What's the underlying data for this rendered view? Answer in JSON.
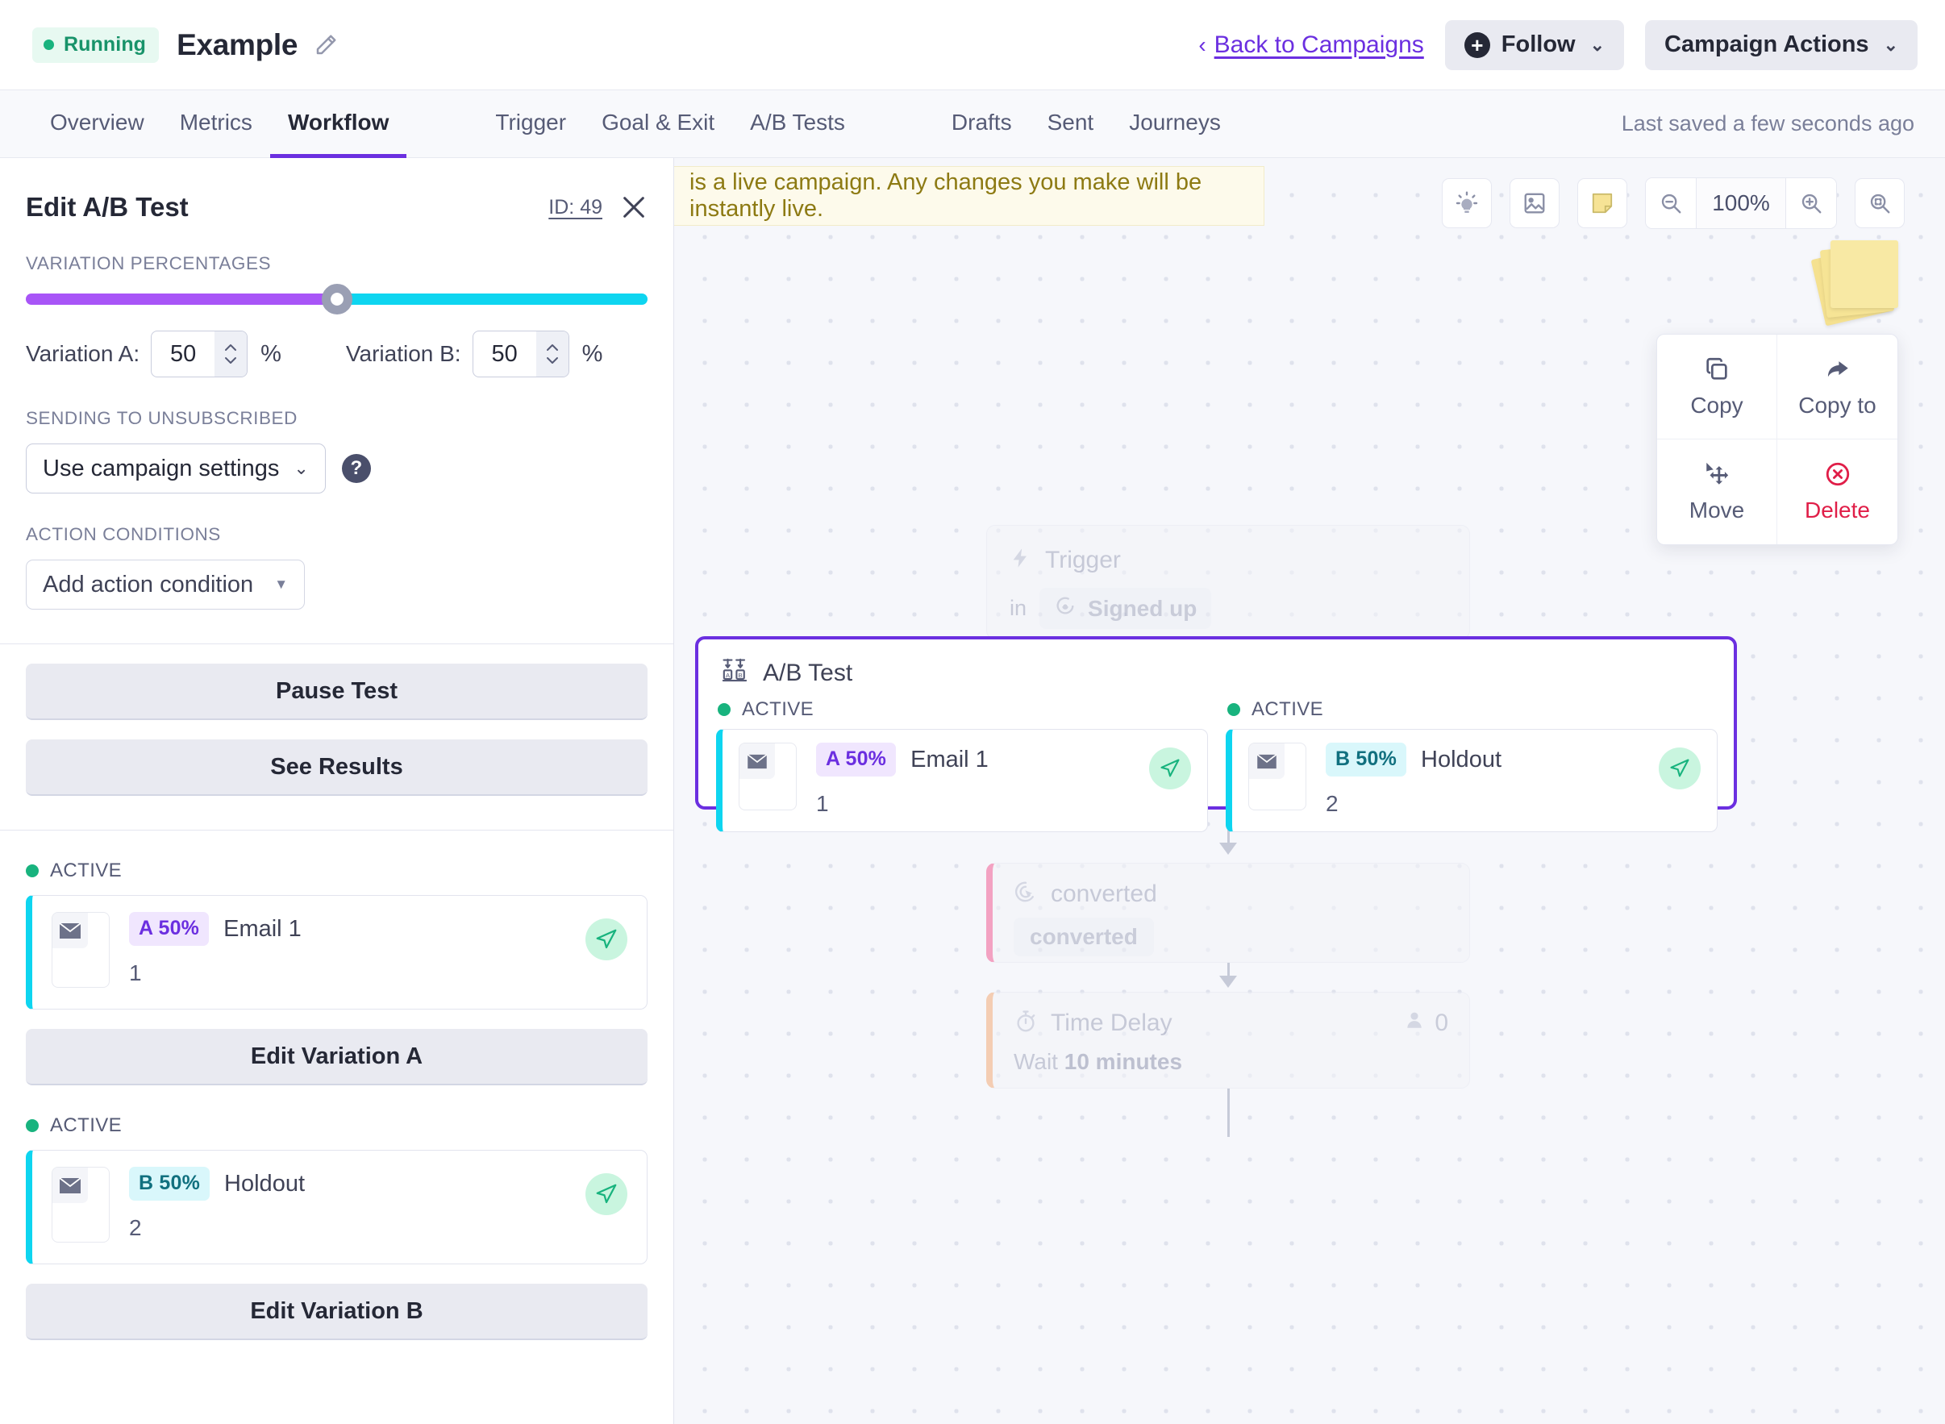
{
  "header": {
    "status_label": "Running",
    "campaign_title": "Example",
    "edit_icon": "pencil-icon",
    "back_link": "Back to Campaigns",
    "back_chevron": "‹",
    "follow_label": "Follow",
    "campaign_actions_label": "Campaign Actions",
    "caret": "⌄"
  },
  "tabs": {
    "group1": [
      "Overview",
      "Metrics",
      "Workflow"
    ],
    "group2": [
      "Trigger",
      "Goal & Exit",
      "A/B Tests"
    ],
    "group3": [
      "Drafts",
      "Sent",
      "Journeys"
    ],
    "active": "Workflow",
    "saved_note": "Last saved a few seconds ago"
  },
  "panel": {
    "title": "Edit A/B Test",
    "id_label": "ID: 49",
    "close_icon": "close-icon",
    "variation_percentages_label": "VARIATION PERCENTAGES",
    "slider": {
      "a_percent": 50,
      "b_percent": 50
    },
    "variation_a_label": "Variation A:",
    "variation_a_value": "50",
    "variation_b_label": "Variation B:",
    "variation_b_value": "50",
    "percent_symbol": "%",
    "sending_label": "SENDING TO UNSUBSCRIBED",
    "sending_value": "Use campaign settings",
    "help_icon": "question-mark-icon",
    "action_conditions_label": "ACTION CONDITIONS",
    "add_action_condition": "Add action condition",
    "pause_test_label": "Pause Test",
    "see_results_label": "See Results",
    "variations": [
      {
        "status": "ACTIVE",
        "badge": "A 50%",
        "name": "Email 1",
        "sub": "1",
        "edit_label": "Edit Variation A",
        "badge_bg": "#f0e6fe",
        "badge_fg": "#6b2fe0"
      },
      {
        "status": "ACTIVE",
        "badge": "B 50%",
        "name": "Holdout",
        "sub": "2",
        "edit_label": "Edit Variation B",
        "badge_bg": "#d9f7fb",
        "badge_fg": "#11707f"
      }
    ]
  },
  "canvas": {
    "banner_text": "is a live campaign. Any changes you make will be instantly live.",
    "zoom_level": "100%",
    "tools": [
      "lightbulb-icon",
      "image-icon",
      "sticky-note-icon",
      "zoom-out-icon",
      "zoom-in-icon",
      "zoom-fit-icon"
    ],
    "context_menu": [
      {
        "label": "Copy",
        "icon": "copy-icon"
      },
      {
        "label": "Copy to",
        "icon": "share-arrow-icon"
      },
      {
        "label": "Move",
        "icon": "move-icon"
      },
      {
        "label": "Delete",
        "icon": "delete-circle-icon"
      }
    ],
    "nodes": {
      "trigger": {
        "title": "Trigger",
        "prefix": "in",
        "chip": "Signed up",
        "icon": "lightning-icon",
        "chip_icon": "segment-icon"
      },
      "abtest": {
        "title": "A/B Test",
        "icon": "ab-test-icon",
        "variations": [
          {
            "status": "ACTIVE",
            "badge": "A 50%",
            "name": "Email 1",
            "sub": "1"
          },
          {
            "status": "ACTIVE",
            "badge": "B 50%",
            "name": "Holdout",
            "sub": "2"
          }
        ]
      },
      "converted": {
        "title": "converted",
        "chip": "converted",
        "icon": "click-target-icon"
      },
      "delay": {
        "title": "Time Delay",
        "wait_prefix": "Wait",
        "wait_value": "10 minutes",
        "count": "0",
        "icon": "stopwatch-icon",
        "people_icon": "person-icon"
      }
    }
  },
  "colors": {
    "accent_purple": "#6b2fe0",
    "variation_a": "#a855f7",
    "variation_b": "#0ed5f0",
    "active_green": "#18b37e",
    "danger_red": "#e01e48"
  }
}
